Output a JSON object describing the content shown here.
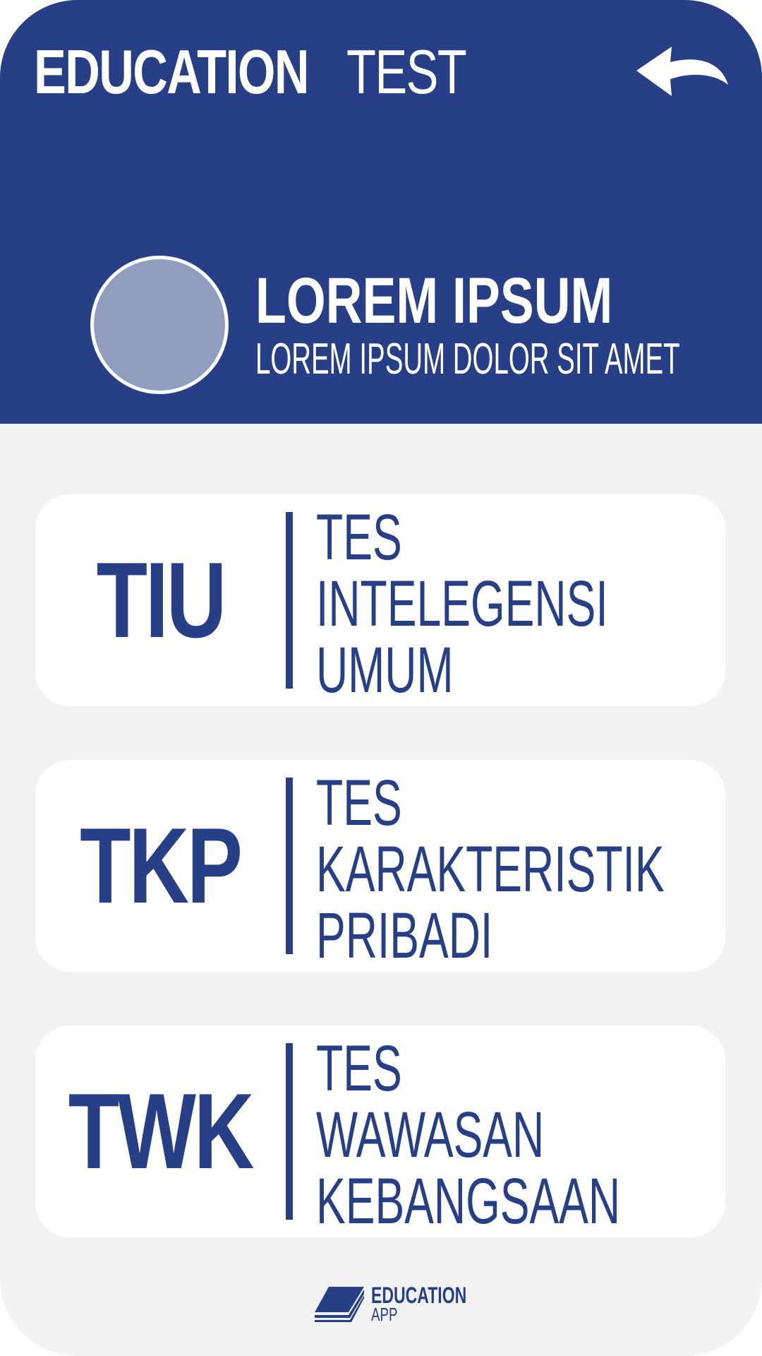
{
  "header": {
    "title_strong": "EDUCATION",
    "title_light": "TEST"
  },
  "profile": {
    "name": "LOREM IPSUM",
    "subtitle": "LOREM IPSUM DOLOR SIT AMET"
  },
  "tests": [
    {
      "code": "TIU",
      "desc": [
        "TES",
        "INTELEGENSI",
        "UMUM"
      ]
    },
    {
      "code": "TKP",
      "desc": [
        "TES",
        "KARAKTERISTIK",
        "PRIBADI"
      ]
    },
    {
      "code": "TWK",
      "desc": [
        "TES",
        "WAWASAN",
        "KEBANGSAAN"
      ]
    }
  ],
  "footer": {
    "brand": "EDUCATION",
    "brand_sub": "APP",
    "icon": "book-icon"
  },
  "icons": {
    "back": "back-arrow-icon"
  },
  "colors": {
    "primary": "#263f86",
    "background": "#f2f2f2",
    "card": "#ffffff",
    "avatar": "#909dbf"
  }
}
